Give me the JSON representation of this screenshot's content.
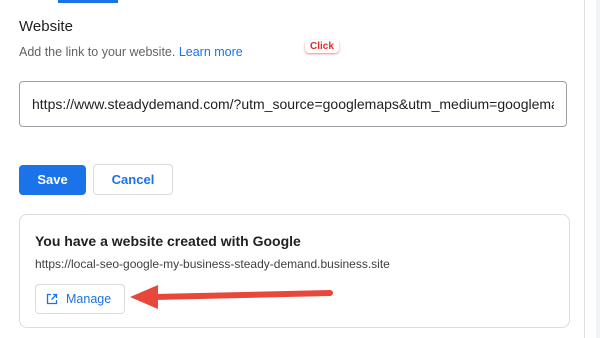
{
  "website": {
    "title": "Website",
    "hint": "Add the link to your website.",
    "learn_more": "Learn more",
    "url_value": "https://www.steadydemand.com/?utm_source=googlemaps&utm_medium=googlemaps",
    "url_placeholder": ""
  },
  "annotation": {
    "click_label": "Click"
  },
  "actions": {
    "save_label": "Save",
    "cancel_label": "Cancel"
  },
  "google_site": {
    "title": "You have a website created with Google",
    "url": "https://local-seo-google-my-business-steady-demand.business.site",
    "manage_label": "Manage",
    "manage_icon": "open-in-new-icon"
  },
  "colors": {
    "accent": "#1a73e8",
    "annotation_red": "#e8473b"
  }
}
